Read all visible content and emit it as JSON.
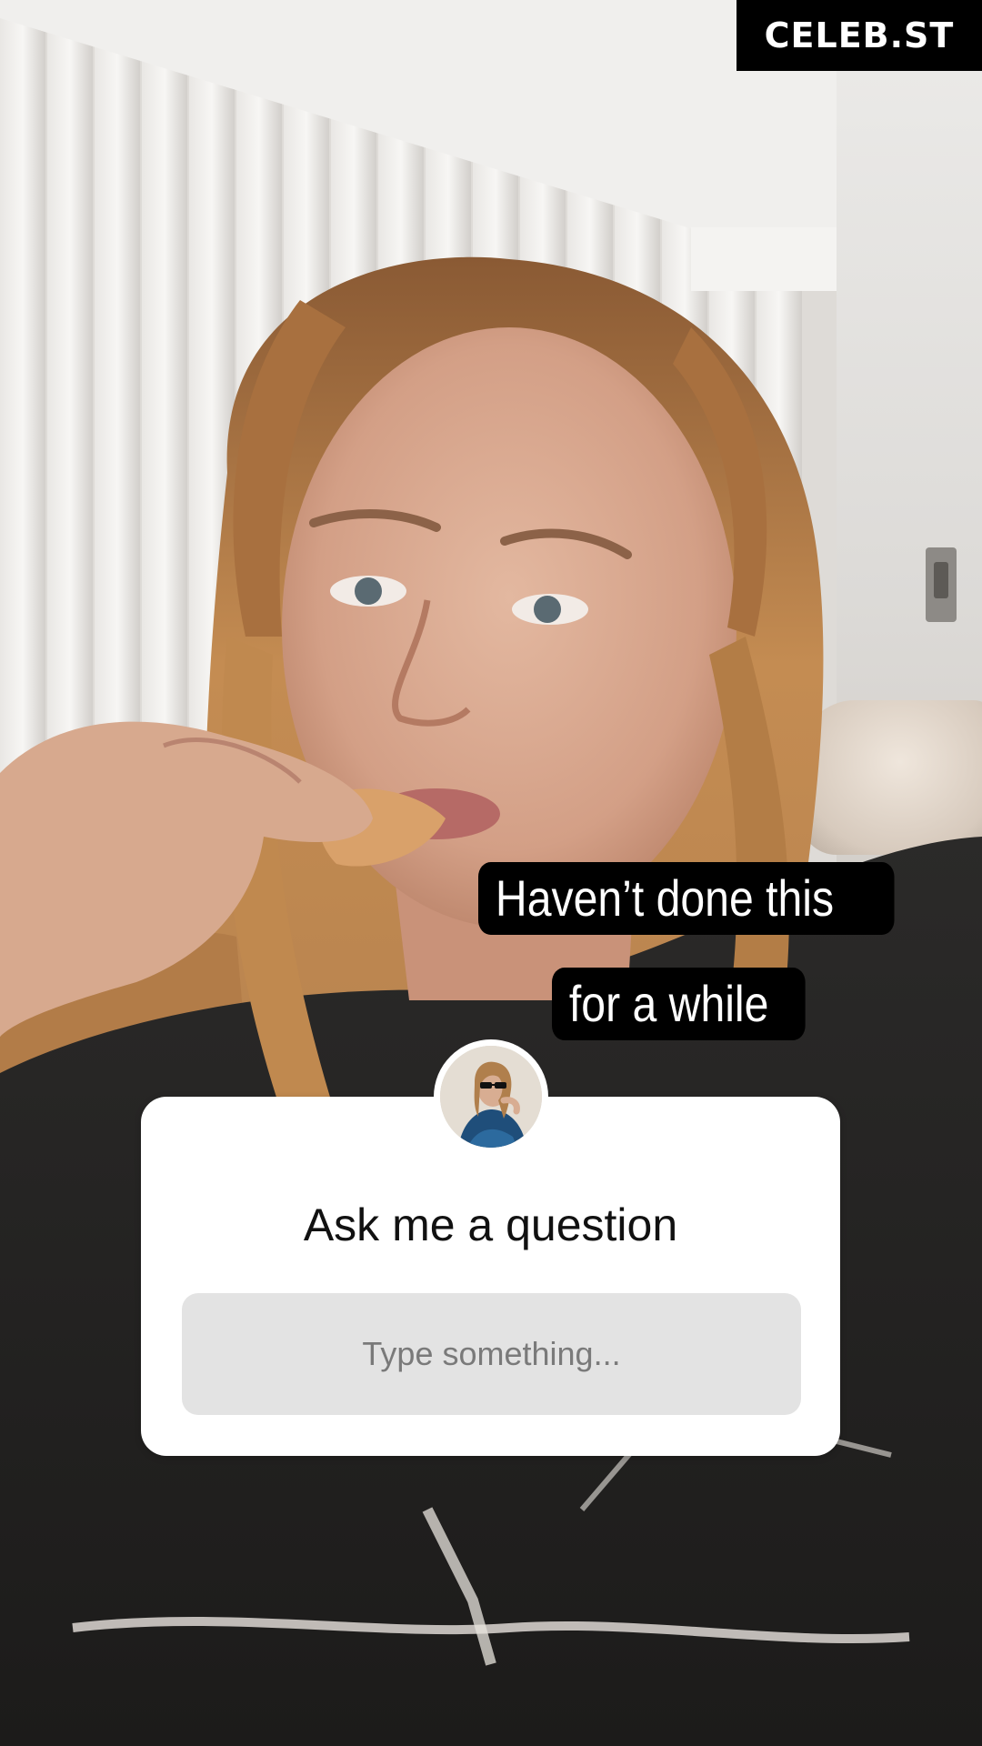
{
  "watermark": {
    "text": "CELEB.ST"
  },
  "captions": {
    "line1": "Haven’t done this",
    "line2": "for a while"
  },
  "question_sticker": {
    "title": "Ask me a question",
    "input_placeholder": "Type something..."
  },
  "colors": {
    "caption_bg": "#000000",
    "caption_text": "#ffffff",
    "card_bg": "#ffffff",
    "input_bg": "#e3e3e3",
    "placeholder_text": "#7a7a7a"
  },
  "icons": {
    "avatar": "profile-photo-avatar"
  }
}
